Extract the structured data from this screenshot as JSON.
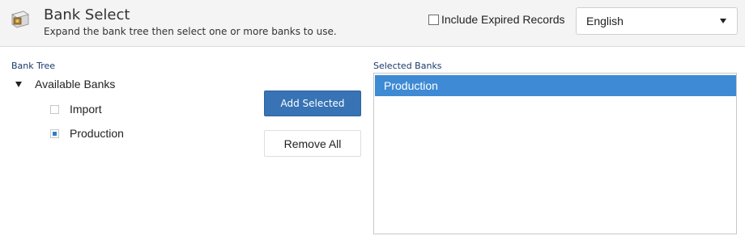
{
  "header": {
    "title": "Bank Select",
    "subtitle": "Expand the bank tree then select one or more banks to use.",
    "icon": "bank-vault-icon",
    "include_expired_label": "Include Expired Records",
    "include_expired_checked": false,
    "language": "English"
  },
  "tree": {
    "label": "Bank Tree",
    "root_label": "Available Banks",
    "expanded": true,
    "items": [
      {
        "label": "Import",
        "checked": false
      },
      {
        "label": "Production",
        "checked": true
      }
    ]
  },
  "actions": {
    "add_label": "Add Selected",
    "remove_label": "Remove All"
  },
  "selected": {
    "label": "Selected Banks",
    "items": [
      "Production"
    ]
  },
  "colors": {
    "primary_button": "#3773b5",
    "selected_row": "#3e8ad4",
    "header_bg": "#f4f4f4"
  }
}
